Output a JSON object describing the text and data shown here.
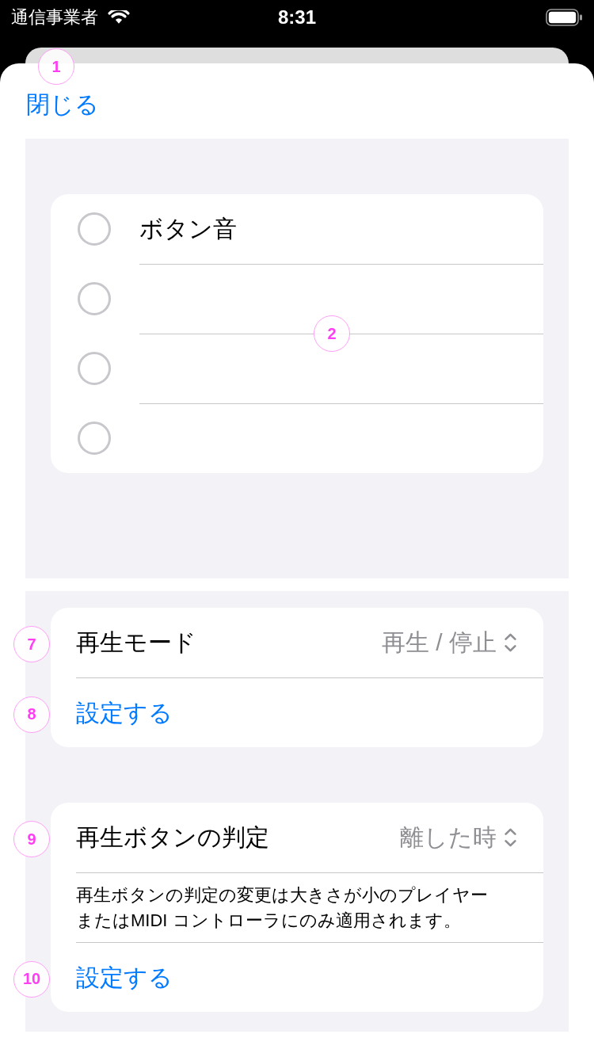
{
  "status_bar": {
    "carrier": "通信事業者",
    "time": "8:31"
  },
  "sheet": {
    "close_label": "閉じる",
    "marker": "1"
  },
  "sound_list": {
    "marker": "2",
    "items": [
      {
        "label": "ボタン音",
        "selected": false
      },
      {
        "selected": false
      },
      {
        "selected": false
      },
      {
        "selected": false
      }
    ]
  },
  "settings_groups": [
    {
      "rows": [
        {
          "kind": "picker",
          "label": "再生モード",
          "value": "再生 / 停止",
          "marker": "7"
        },
        {
          "kind": "action",
          "label": "設定する",
          "marker": "8"
        }
      ]
    },
    {
      "rows": [
        {
          "kind": "picker",
          "label": "再生ボタンの判定",
          "value": "離した時",
          "marker": "9"
        },
        {
          "kind": "note",
          "text": "再生ボタンの判定の変更は大きさが小のプレイヤーまたはMIDI コントローラにのみ適用されます。"
        },
        {
          "kind": "action",
          "label": "設定する",
          "marker": "10"
        }
      ]
    }
  ]
}
